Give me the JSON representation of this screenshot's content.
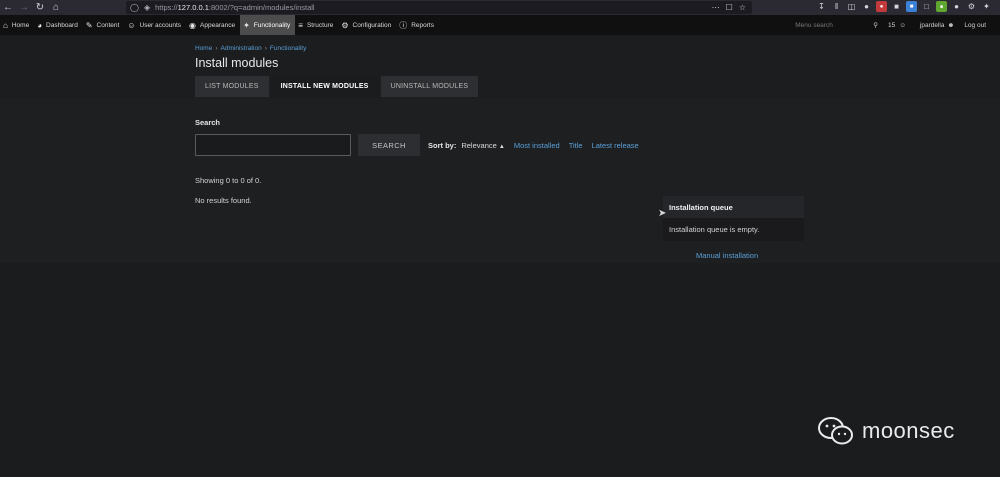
{
  "browser": {
    "url_scheme": "https://",
    "url_host": "127.0.0.1",
    "url_rest": ":8002/?q=admin/modules/install",
    "icons": [
      "back-icon",
      "forward-icon",
      "reload-icon",
      "home-icon",
      "shield-icon",
      "lock-icon",
      "more-icon",
      "pocket-icon",
      "star-icon"
    ]
  },
  "toolbar": {
    "items": [
      {
        "label": "Home",
        "icon": "home-icon"
      },
      {
        "label": "Dashboard",
        "icon": "dashboard-icon"
      },
      {
        "label": "Content",
        "icon": "pencil-icon"
      },
      {
        "label": "User accounts",
        "icon": "users-icon"
      },
      {
        "label": "Appearance",
        "icon": "palette-icon"
      },
      {
        "label": "Functionality",
        "icon": "puzzle-icon"
      },
      {
        "label": "Structure",
        "icon": "layers-icon"
      },
      {
        "label": "Configuration",
        "icon": "gear-icon"
      },
      {
        "label": "Reports",
        "icon": "info-icon"
      }
    ],
    "active_index": 5,
    "search_placeholder": "Menu search",
    "user_count": "15",
    "username": "jpardella",
    "logout": "Log out"
  },
  "breadcrumb": [
    "Home",
    "Administration",
    "Functionality"
  ],
  "page_title": "Install modules",
  "tabs": [
    {
      "label": "LIST MODULES",
      "active": false
    },
    {
      "label": "INSTALL NEW MODULES",
      "active": true
    },
    {
      "label": "UNINSTALL MODULES",
      "active": false
    }
  ],
  "search": {
    "label": "Search",
    "value": "",
    "button": "SEARCH"
  },
  "sort": {
    "label": "Sort by:",
    "current": "Relevance",
    "options": [
      "Most installed",
      "Title",
      "Latest release"
    ]
  },
  "results": {
    "showing": "Showing 0 to 0 of 0.",
    "empty": "No results found."
  },
  "queue": {
    "title": "Installation queue",
    "empty": "Installation queue is empty.",
    "manual_link": "Manual installation"
  },
  "watermark": {
    "text": "moonsec"
  },
  "colors": {
    "link": "#5aa0d8",
    "background": "#1b1c1e",
    "toolbar": "#101011",
    "active_tab": "#4c4c4c"
  }
}
